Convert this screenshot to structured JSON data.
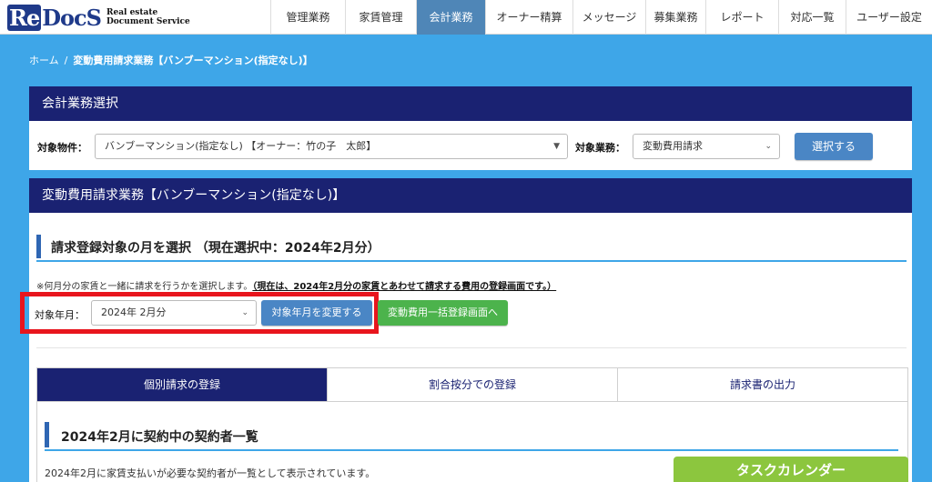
{
  "header": {
    "logo_mark": "ReDocS",
    "logo_line1": "Real estate",
    "logo_line2": "Document Service",
    "nav": [
      {
        "label": "管理業務",
        "active": false
      },
      {
        "label": "家賃管理",
        "active": false
      },
      {
        "label": "会計業務",
        "active": true
      },
      {
        "label": "オーナー精算",
        "active": false
      },
      {
        "label": "メッセージ",
        "active": false
      },
      {
        "label": "募集業務",
        "active": false
      },
      {
        "label": "レポート",
        "active": false
      },
      {
        "label": "対応一覧",
        "active": false
      },
      {
        "label": "ユーザー設定",
        "active": false
      }
    ]
  },
  "breadcrumb": {
    "home": "ホーム",
    "separator": "/",
    "current": "変動費用請求業務【バンブーマンション(指定なし)】"
  },
  "accounting_panel": {
    "title": "会計業務選択",
    "property_label": "対象物件：",
    "property_value": "バンブーマンション(指定なし) 【オーナー：竹の子　太郎】",
    "task_label": "対象業務：",
    "task_value": "変動費用請求",
    "select_button": "選択する"
  },
  "billing_panel": {
    "title": "変動費用請求業務【バンブーマンション(指定なし)】",
    "section_title": "請求登録対象の月を選択 （現在選択中：2024年2月分）",
    "note_prefix": "※何月分の家賃と一緒に請求を行うかを選択します。",
    "note_bold": "（現在は、2024年2月分の家賃とあわせて請求する費用の登録画面です。）",
    "month_label": "対象年月：",
    "month_value": "2024年 2月分",
    "change_button": "対象年月を変更する",
    "bulk_button": "変動費用一括登録画面へ",
    "tabs": [
      {
        "label": "個別請求の登録",
        "active": true
      },
      {
        "label": "割合按分での登録",
        "active": false
      },
      {
        "label": "請求書の出力",
        "active": false
      }
    ],
    "contract_title": "2024年2月に契約中の契約者一覧",
    "contract_desc": "2024年2月に家賃支払いが必要な契約者が一覧として表示されています。"
  },
  "task_calendar": "タスクカレンダー",
  "colors": {
    "background": "#3ea6e8",
    "navy": "#1a2272",
    "active_nav": "#4f86b7",
    "button_blue": "#4a86c5",
    "button_green": "#4cb34c",
    "highlight_red": "#e8151d",
    "task_green": "#8cc63e"
  }
}
